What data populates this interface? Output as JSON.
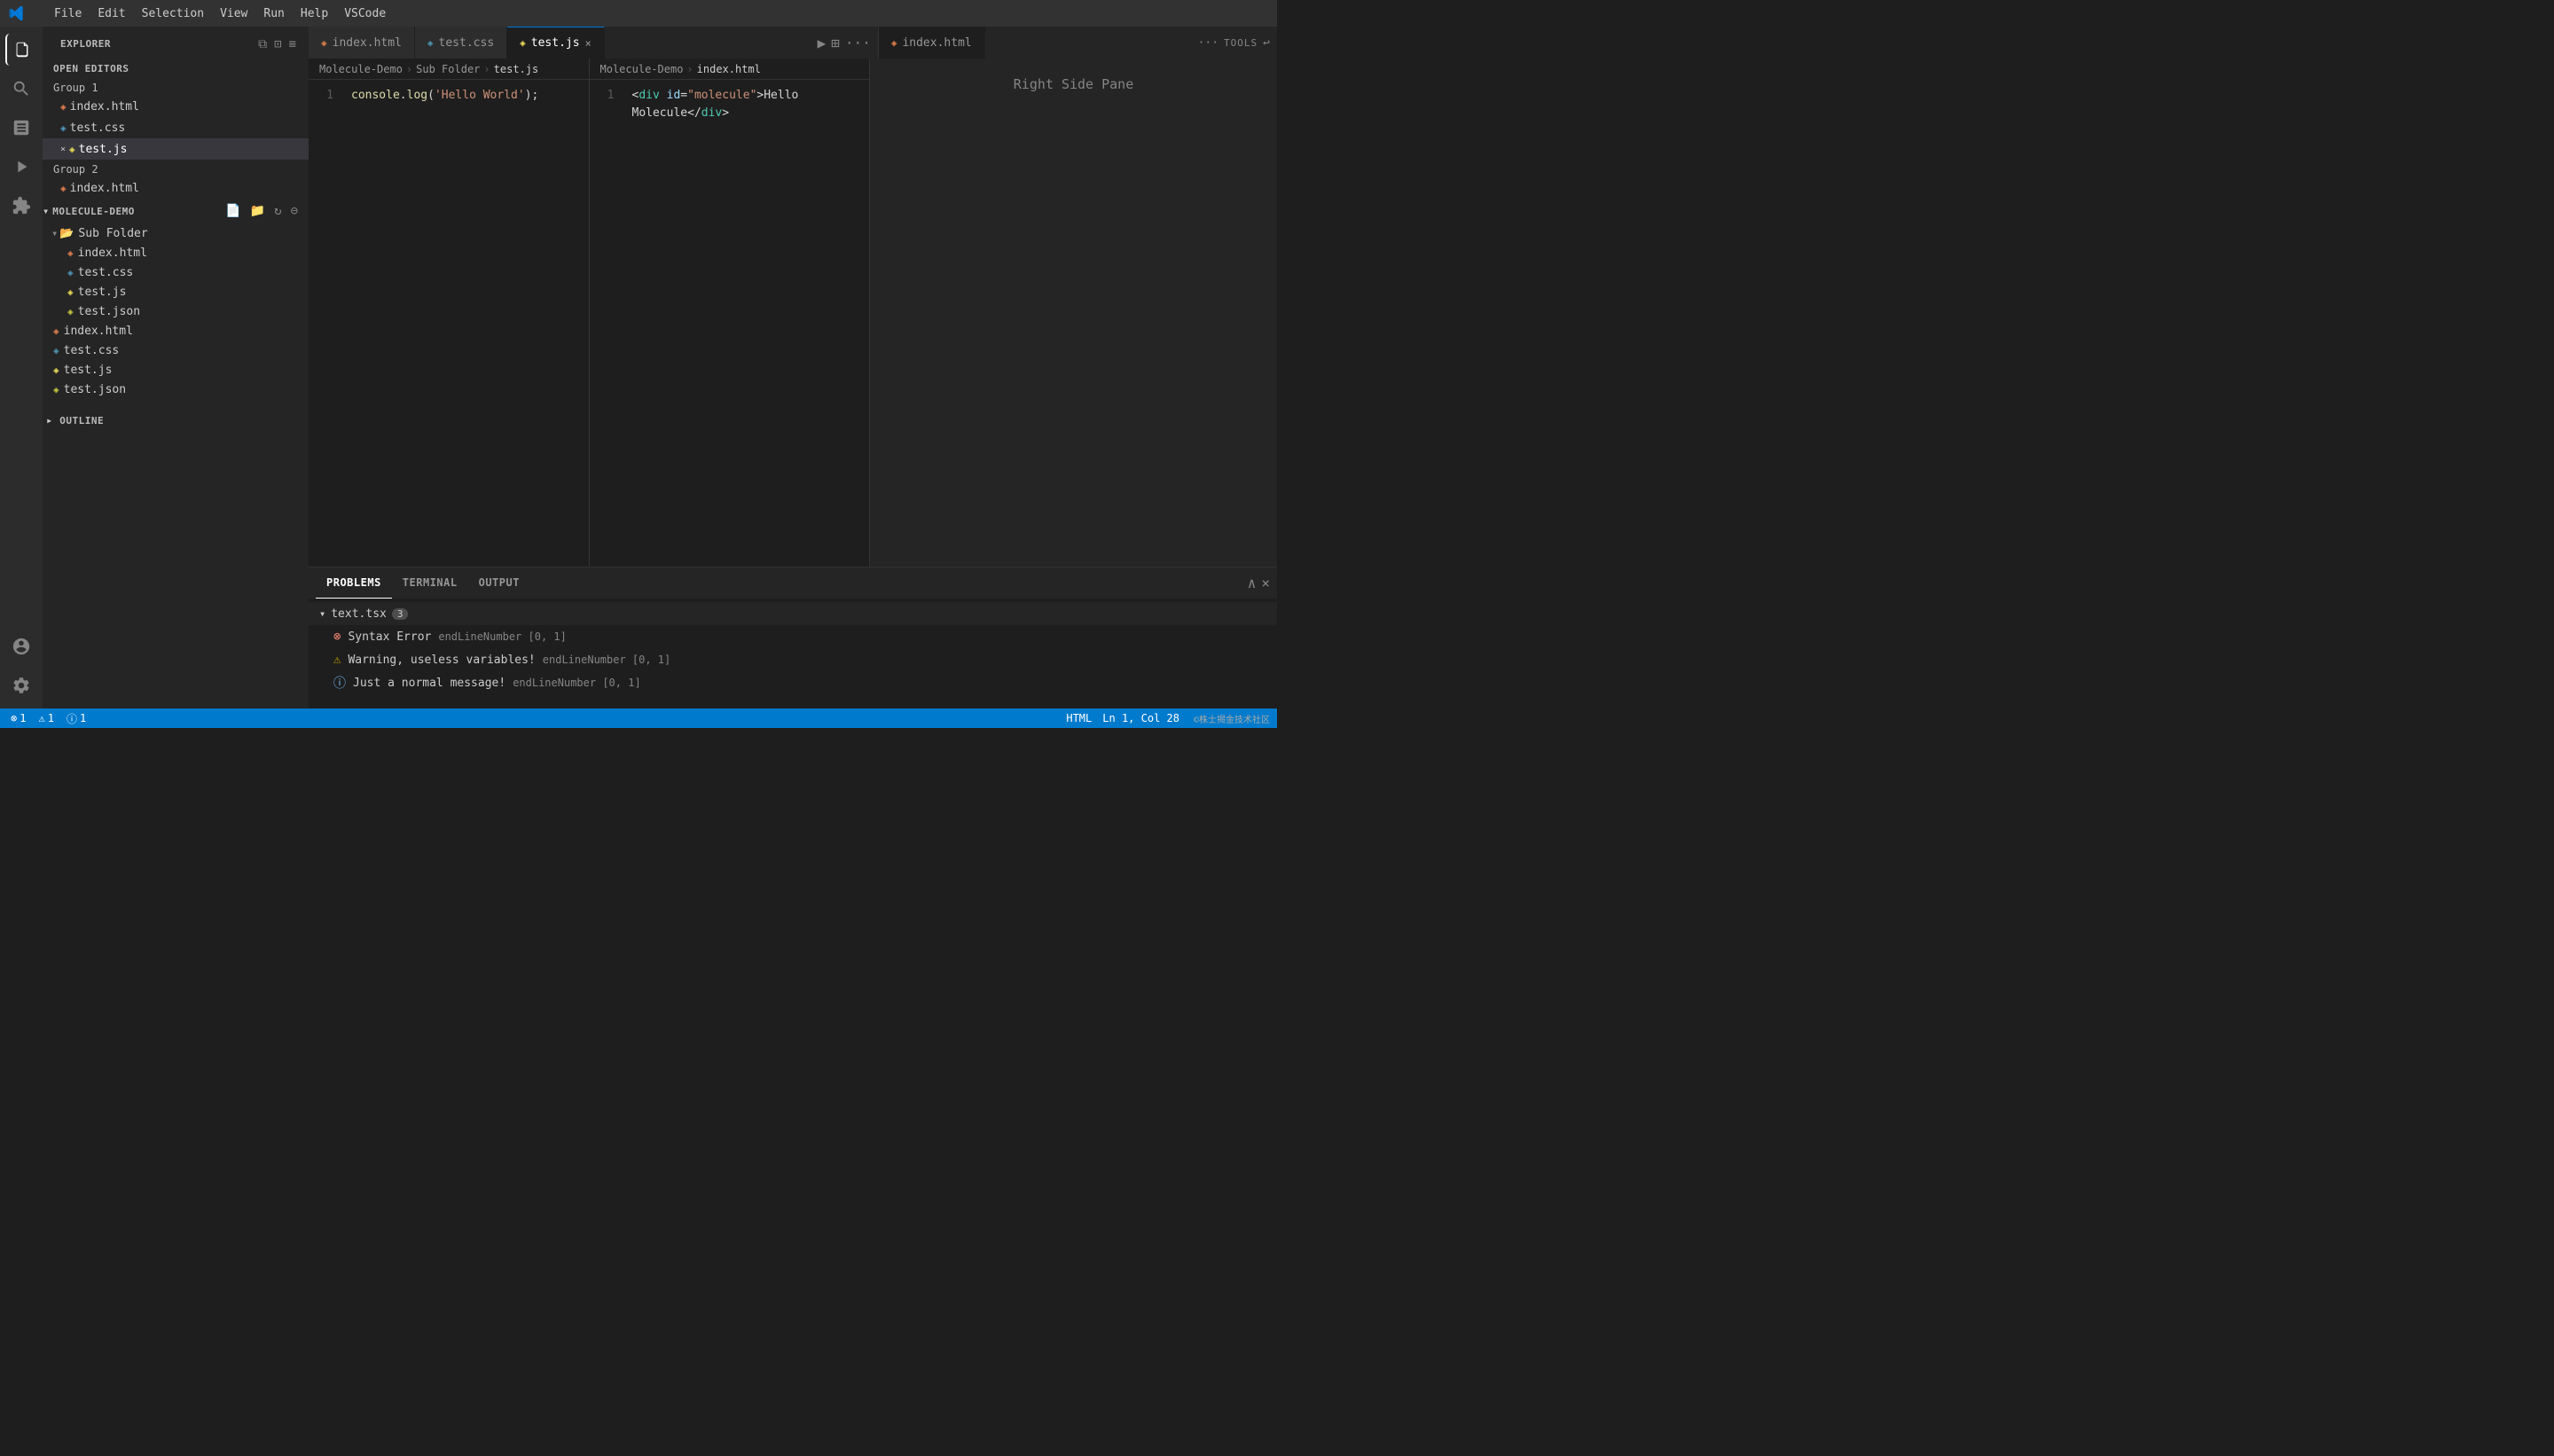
{
  "titleBar": {
    "logo": "vscode-logo",
    "menuItems": [
      "File",
      "Edit",
      "Selection",
      "View",
      "Run",
      "Help",
      "VSCode"
    ]
  },
  "activityBar": {
    "icons": [
      {
        "name": "explorer-icon",
        "symbol": "⧉",
        "active": true
      },
      {
        "name": "search-icon",
        "symbol": "🔍"
      },
      {
        "name": "source-control-icon",
        "symbol": "⑂"
      },
      {
        "name": "debug-icon",
        "symbol": "▷"
      },
      {
        "name": "extensions-icon",
        "symbol": "⊞"
      }
    ],
    "bottomIcons": [
      {
        "name": "account-icon",
        "symbol": "👤"
      },
      {
        "name": "settings-icon",
        "symbol": "⚙"
      }
    ]
  },
  "sidebar": {
    "title": "Explorer",
    "headerIcons": [
      "copy",
      "split",
      "refresh",
      "collapse"
    ],
    "openEditors": {
      "label": "Open Editors",
      "groups": [
        {
          "name": "Group 1",
          "files": [
            {
              "name": "index.html",
              "icon": "html-icon",
              "modified": false
            },
            {
              "name": "test.css",
              "icon": "css-icon",
              "modified": false
            },
            {
              "name": "test.js",
              "icon": "js-icon",
              "modified": true,
              "active": true
            }
          ]
        },
        {
          "name": "Group 2",
          "files": [
            {
              "name": "index.html",
              "icon": "html-icon",
              "modified": false
            }
          ]
        }
      ]
    },
    "explorer": {
      "label": "Molecule-Demo",
      "folderIcons": [
        "new-file",
        "new-folder",
        "refresh",
        "collapse"
      ],
      "items": [
        {
          "type": "folder",
          "name": "Sub Folder",
          "expanded": true,
          "depth": 0
        },
        {
          "type": "file",
          "name": "index.html",
          "depth": 1
        },
        {
          "type": "file",
          "name": "test.css",
          "depth": 1
        },
        {
          "type": "file",
          "name": "test.js",
          "depth": 1
        },
        {
          "type": "file",
          "name": "test.json",
          "depth": 1
        },
        {
          "type": "file",
          "name": "index.html",
          "depth": 0
        },
        {
          "type": "file",
          "name": "test.css",
          "depth": 0
        },
        {
          "type": "file",
          "name": "test.js",
          "depth": 0
        },
        {
          "type": "file",
          "name": "test.json",
          "depth": 0
        }
      ],
      "outline": {
        "label": "Outline"
      }
    }
  },
  "tabs": {
    "left": [
      {
        "name": "index.html",
        "active": false,
        "modified": false
      },
      {
        "name": "test.css",
        "active": false,
        "modified": false
      },
      {
        "name": "test.js",
        "active": true,
        "modified": true
      }
    ],
    "right": [
      {
        "name": "index.html",
        "active": false,
        "modified": false
      }
    ],
    "leftActions": [
      "▶",
      "⊞",
      "···"
    ],
    "rightActions": [
      "···",
      "TOOLS",
      "↩"
    ]
  },
  "editors": {
    "left": {
      "breadcrumb": [
        "Molecule-Demo",
        "Sub Folder",
        "test.js"
      ],
      "lines": [
        {
          "num": "1",
          "content": "console.log('Hello World');"
        }
      ]
    },
    "right": {
      "breadcrumb": [
        "Molecule-Demo",
        "index.html"
      ],
      "lines": [
        {
          "num": "1",
          "content": "<div id=\"molecule\">Hello Molecule</div>"
        }
      ]
    }
  },
  "rightPane": {
    "label": "Right Side Pane"
  },
  "bottomPanel": {
    "tabs": [
      {
        "name": "PROBLEMS",
        "active": true
      },
      {
        "name": "TERMINAL",
        "active": false
      },
      {
        "name": "OUTPUT",
        "active": false
      }
    ],
    "problemGroup": {
      "filename": "text.tsx",
      "count": "3",
      "problems": [
        {
          "type": "error",
          "icon": "⊗",
          "message": "Syntax Error",
          "detail": "endLineNumber  [0, 1]"
        },
        {
          "type": "warning",
          "icon": "⚠",
          "message": "Warning, useless variables!",
          "detail": "endLineNumber  [0, 1]"
        },
        {
          "type": "info",
          "icon": "ⓘ",
          "message": "Just a normal message!",
          "detail": "endLineNumber  [0, 1]"
        }
      ]
    }
  },
  "statusBar": {
    "left": [
      {
        "text": "⊗ 1",
        "name": "errors-count"
      },
      {
        "text": "⚠ 1",
        "name": "warnings-count"
      },
      {
        "text": "⓪ 1",
        "name": "info-count"
      }
    ],
    "right": {
      "position": "Ln 1, Col 28",
      "language": "HTML",
      "watermark": "©株士揭金技术社区"
    }
  }
}
